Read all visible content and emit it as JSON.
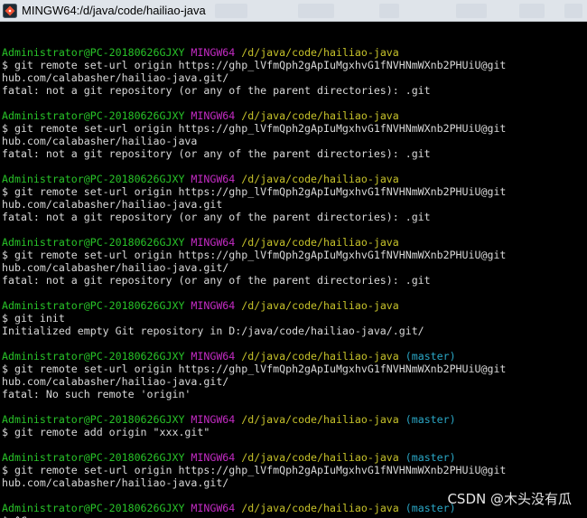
{
  "window": {
    "title": "MINGW64:/d/java/code/hailiao-java"
  },
  "prompt": {
    "user": "Administrator@PC-20180626GJXY",
    "env": "MINGW64",
    "path": "/d/java/code/hailiao-java",
    "branch": "(master)"
  },
  "blocks": [
    {
      "has_branch": false,
      "lines": [
        "$ git remote set-url origin https://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@git",
        "hub.com/calabasher/hailiao-java.git/",
        "fatal: not a git repository (or any of the parent directories): .git"
      ]
    },
    {
      "has_branch": false,
      "lines": [
        "$ git remote set-url origin https://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@git",
        "hub.com/calabasher/hailiao-java",
        "fatal: not a git repository (or any of the parent directories): .git"
      ]
    },
    {
      "has_branch": false,
      "lines": [
        "$ git remote set-url origin https://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@git",
        "hub.com/calabasher/hailiao-java.git",
        "fatal: not a git repository (or any of the parent directories): .git"
      ]
    },
    {
      "has_branch": false,
      "lines": [
        "$ git remote set-url origin https://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@git",
        "hub.com/calabasher/hailiao-java.git/",
        "fatal: not a git repository (or any of the parent directories): .git"
      ]
    },
    {
      "has_branch": false,
      "lines": [
        "$ git init",
        "Initialized empty Git repository in D:/java/code/hailiao-java/.git/"
      ]
    },
    {
      "has_branch": true,
      "lines": [
        "$ git remote set-url origin https://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@git",
        "hub.com/calabasher/hailiao-java.git/",
        "fatal: No such remote 'origin'"
      ]
    },
    {
      "has_branch": true,
      "lines": [
        "$ git remote add origin \"xxx.git\""
      ]
    },
    {
      "has_branch": true,
      "lines": [
        "$ git remote set-url origin https://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@git",
        "hub.com/calabasher/hailiao-java.git/"
      ]
    },
    {
      "has_branch": true,
      "lines": [
        "$ ^C"
      ]
    }
  ],
  "watermark": "CSDN @木头没有瓜",
  "colors": {
    "background": "#000000",
    "text": "#d9d9d9",
    "user": "#28c328",
    "env": "#c42bc4",
    "path": "#c6c22a",
    "branch": "#2aa7c6"
  }
}
